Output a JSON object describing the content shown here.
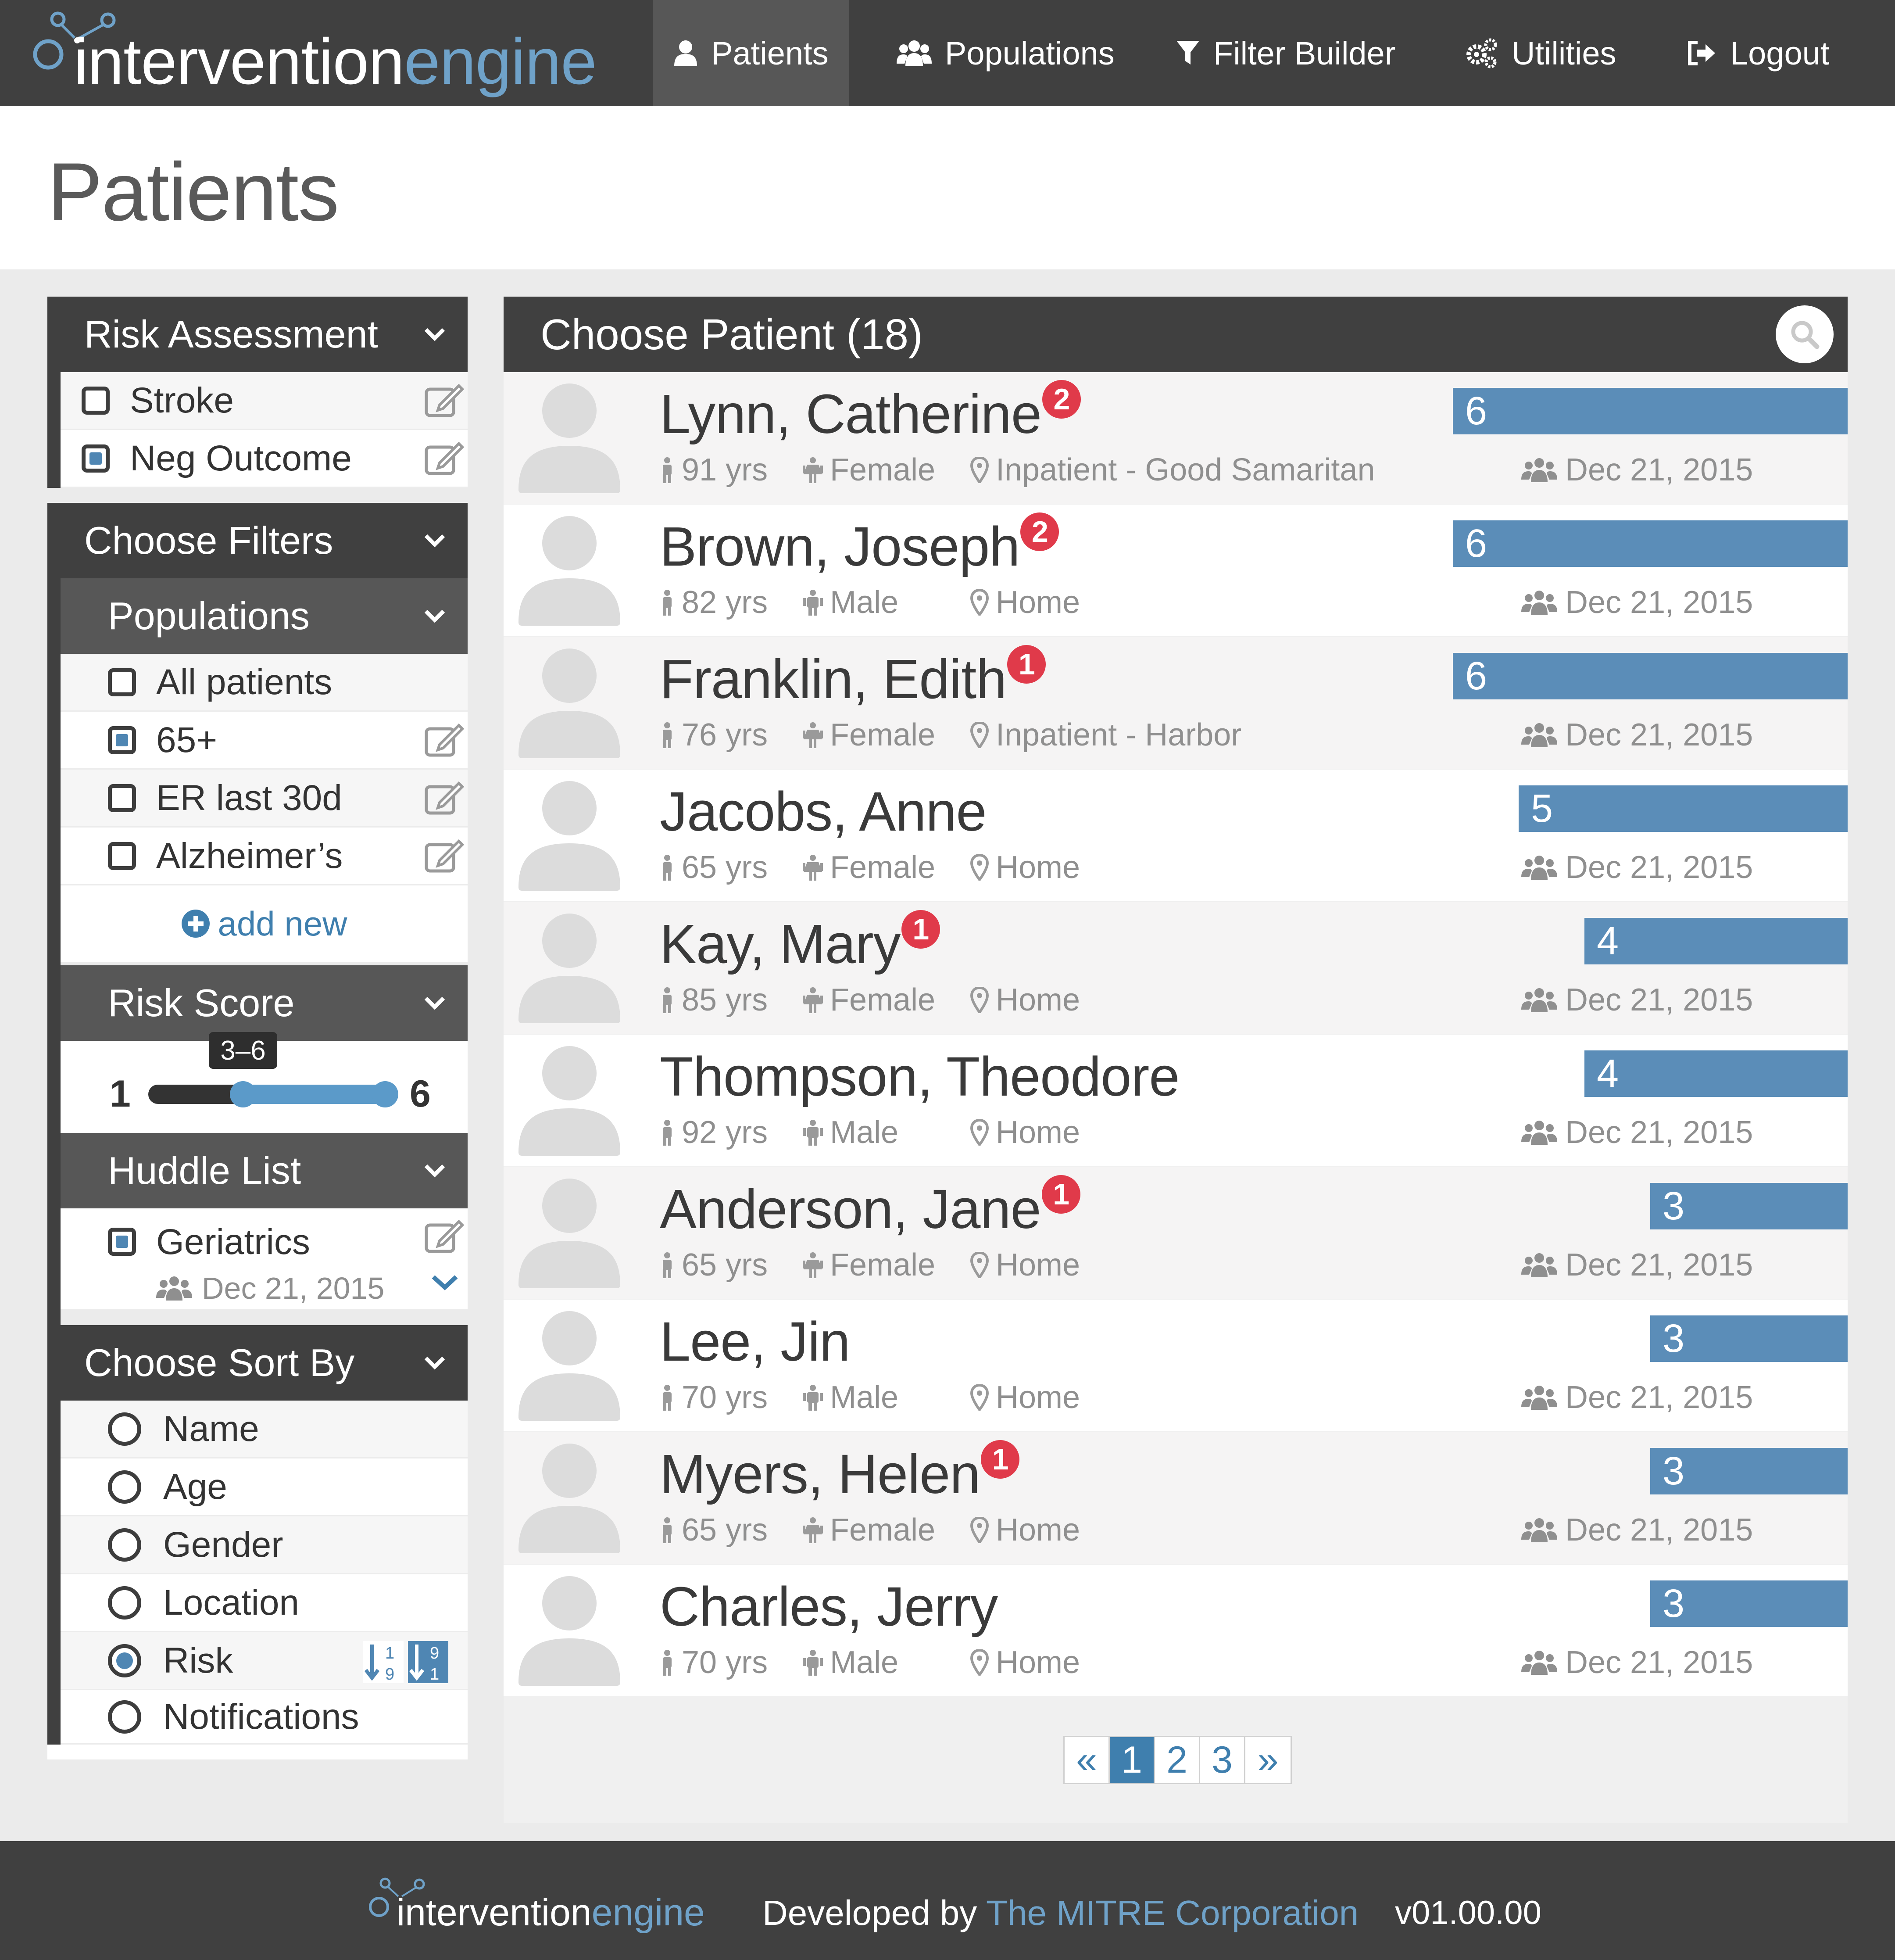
{
  "app": {
    "logo_part1": "intervention",
    "logo_part2": "engine"
  },
  "nav": [
    {
      "label": "Patients",
      "icon": "user-icon",
      "active": true
    },
    {
      "label": "Populations",
      "icon": "users-icon",
      "active": false
    },
    {
      "label": "Filter Builder",
      "icon": "filter-icon",
      "active": false
    },
    {
      "label": "Utilities",
      "icon": "cogs-icon",
      "active": false
    },
    {
      "label": "Logout",
      "icon": "sign-out-icon",
      "active": false
    }
  ],
  "page_title": "Patients",
  "sidebar": {
    "risk_assessment": {
      "title": "Risk Assessment",
      "items": [
        {
          "label": "Stroke",
          "checked": false
        },
        {
          "label": "Neg Outcome",
          "checked": true
        }
      ]
    },
    "choose_filters": {
      "title": "Choose Filters",
      "populations": {
        "title": "Populations",
        "items": [
          {
            "label": "All patients",
            "checked": false
          },
          {
            "label": "65+",
            "checked": true
          },
          {
            "label": "ER last 30d",
            "checked": false
          },
          {
            "label": "Alzheimer’s",
            "checked": false
          }
        ],
        "add_new": "add new"
      },
      "risk_score": {
        "title": "Risk Score",
        "min_label": "1",
        "max_label": "6",
        "range_label": "3–6",
        "range_min": 1,
        "range_max": 6,
        "selected_low": 3,
        "selected_high": 6
      },
      "huddle_list": {
        "title": "Huddle List",
        "item_label": "Geriatrics",
        "item_checked": true,
        "item_date": "Dec 21, 2015"
      }
    },
    "sort_by": {
      "title": "Choose Sort By",
      "options": [
        {
          "label": "Name",
          "selected": false
        },
        {
          "label": "Age",
          "selected": false
        },
        {
          "label": "Gender",
          "selected": false
        },
        {
          "label": "Location",
          "selected": false
        },
        {
          "label": "Risk",
          "selected": true
        },
        {
          "label": "Notifications",
          "selected": false
        }
      ]
    }
  },
  "patients_panel": {
    "title": "Choose Patient (18)",
    "max_risk": 6,
    "patients": [
      {
        "name": "Lynn, Catherine",
        "badge": "2",
        "age": "91 yrs",
        "gender": "Female",
        "location": "Inpatient - Good Samaritan",
        "risk": 6,
        "date": "Dec 21, 2015"
      },
      {
        "name": "Brown, Joseph",
        "badge": "2",
        "age": "82 yrs",
        "gender": "Male",
        "location": "Home",
        "risk": 6,
        "date": "Dec 21, 2015"
      },
      {
        "name": "Franklin, Edith",
        "badge": "1",
        "age": "76 yrs",
        "gender": "Female",
        "location": "Inpatient - Harbor",
        "risk": 6,
        "date": "Dec 21, 2015"
      },
      {
        "name": "Jacobs, Anne",
        "badge": "",
        "age": "65 yrs",
        "gender": "Female",
        "location": "Home",
        "risk": 5,
        "date": "Dec 21, 2015"
      },
      {
        "name": "Kay, Mary",
        "badge": "1",
        "age": "85 yrs",
        "gender": "Female",
        "location": "Home",
        "risk": 4,
        "date": "Dec 21, 2015"
      },
      {
        "name": "Thompson, Theodore",
        "badge": "",
        "age": "92 yrs",
        "gender": "Male",
        "location": "Home",
        "risk": 4,
        "date": "Dec 21, 2015"
      },
      {
        "name": "Anderson, Jane",
        "badge": "1",
        "age": "65 yrs",
        "gender": "Female",
        "location": "Home",
        "risk": 3,
        "date": "Dec 21, 2015"
      },
      {
        "name": "Lee, Jin",
        "badge": "",
        "age": "70 yrs",
        "gender": "Male",
        "location": "Home",
        "risk": 3,
        "date": "Dec 21, 2015"
      },
      {
        "name": "Myers, Helen",
        "badge": "1",
        "age": "65 yrs",
        "gender": "Female",
        "location": "Home",
        "risk": 3,
        "date": "Dec 21, 2015"
      },
      {
        "name": "Charles, Jerry",
        "badge": "",
        "age": "70 yrs",
        "gender": "Male",
        "location": "Home",
        "risk": 3,
        "date": "Dec 21, 2015"
      }
    ],
    "pagination": {
      "prev": "«",
      "pages": [
        "1",
        "2",
        "3"
      ],
      "current": "1",
      "next": "»"
    }
  },
  "footer": {
    "developed_by": "Developed by",
    "corporation": "The MITRE Corporation",
    "version": "v01.00.00"
  },
  "colors": {
    "header_bg": "#404040",
    "accent": "#5b8db8",
    "badge": "#e03a4a",
    "logo_blue": "#6fa2c9"
  }
}
